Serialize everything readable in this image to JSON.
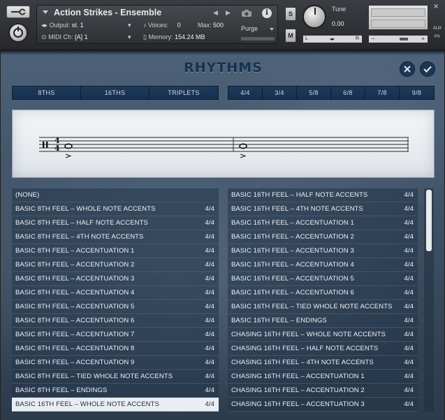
{
  "header": {
    "instrument_title": "Action Strikes - Ensemble",
    "output_label": "Output:",
    "output_value": "st. 1",
    "midi_label": "MIDI Ch:",
    "midi_value": "[A]  1",
    "voices_label": "Voices:",
    "voices_value": "0",
    "max_label": "Max:",
    "max_value": "500",
    "memory_label": "Memory:",
    "memory_value": "154.24 MB",
    "purge_label": "Purge",
    "solo_label": "S",
    "mute_label": "M",
    "tune_label": "Tune",
    "tune_value": "0.00",
    "pan_left": "L",
    "pan_right": "R",
    "vol_minus": "−",
    "vol_plus": "+",
    "aux_label": "AUX",
    "pv_label": "PV",
    "close_x": "×"
  },
  "panel": {
    "title": "RHYTHMS"
  },
  "feel_tabs": [
    "8THS",
    "16THS",
    "TRIPLETS"
  ],
  "meter_tabs": [
    "4/4",
    "3/4",
    "5/8",
    "6/8",
    "7/8",
    "9/8"
  ],
  "notation": {
    "time_signature_top": "4",
    "time_signature_bottom": "4"
  },
  "left_list": [
    {
      "name": "(NONE)",
      "meter": ""
    },
    {
      "name": "BASIC 8TH FEEL – WHOLE NOTE ACCENTS",
      "meter": "4/4"
    },
    {
      "name": "BASIC 8TH FEEL – HALF NOTE ACCENTS",
      "meter": "4/4"
    },
    {
      "name": "BASIC 8TH FEEL – 4TH NOTE ACCENTS",
      "meter": "4/4"
    },
    {
      "name": "BASIC 8TH FEEL – ACCENTUATION 1",
      "meter": "4/4"
    },
    {
      "name": "BASIC 8TH FEEL – ACCENTUATION 2",
      "meter": "4/4"
    },
    {
      "name": "BASIC 8TH FEEL – ACCENTUATION 3",
      "meter": "4/4"
    },
    {
      "name": "BASIC 8TH FEEL – ACCENTUATION 4",
      "meter": "4/4"
    },
    {
      "name": "BASIC 8TH FEEL – ACCENTUATION 5",
      "meter": "4/4"
    },
    {
      "name": "BASIC 8TH FEEL – ACCENTUATION 6",
      "meter": "4/4"
    },
    {
      "name": "BASIC 8TH FEEL – ACCENTUATION 7",
      "meter": "4/4"
    },
    {
      "name": "BASIC 8TH FEEL – ACCENTUATION 8",
      "meter": "4/4"
    },
    {
      "name": "BASIC 8TH FEEL – ACCENTUATION 9",
      "meter": "4/4"
    },
    {
      "name": "BASIC 8TH FEEL – TIED WHOLE NOTE ACCENTS",
      "meter": "4/4"
    },
    {
      "name": "BASIC 8TH FEEL – ENDINGS",
      "meter": "4/4"
    },
    {
      "name": "BASIC 16TH FEEL – WHOLE NOTE ACCENTS",
      "meter": "4/4",
      "selected": true
    }
  ],
  "right_list": [
    {
      "name": "BASIC 16TH FEEL – HALF NOTE ACCENTS",
      "meter": "4/4"
    },
    {
      "name": "BASIC 16TH FEEL – 4TH NOTE ACCENTS",
      "meter": "4/4"
    },
    {
      "name": "BASIC 16TH FEEL – ACCENTUATION 1",
      "meter": "4/4"
    },
    {
      "name": "BASIC 16TH FEEL – ACCENTUATION 2",
      "meter": "4/4"
    },
    {
      "name": "BASIC 16TH FEEL – ACCENTUATION 3",
      "meter": "4/4"
    },
    {
      "name": "BASIC 16TH FEEL – ACCENTUATION 4",
      "meter": "4/4"
    },
    {
      "name": "BASIC 16TH FEEL – ACCENTUATION 5",
      "meter": "4/4"
    },
    {
      "name": "BASIC 16TH FEEL – ACCENTUATION 6",
      "meter": "4/4"
    },
    {
      "name": "BASIC 16TH FEEL – TIED WHOLE NOTE ACCENTS",
      "meter": "4/4"
    },
    {
      "name": "BASIC 16TH FEEL – ENDINGS",
      "meter": "4/4"
    },
    {
      "name": "CHASING 16TH FEEL – WHOLE NOTE ACCENTS",
      "meter": "4/4"
    },
    {
      "name": "CHASING 16TH FEEL – HALF NOTE ACCENTS",
      "meter": "4/4"
    },
    {
      "name": "CHASING 16TH FEEL – 4TH NOTE ACCENTS",
      "meter": "4/4"
    },
    {
      "name": "CHASING 16TH FEEL – ACCENTUATION 1",
      "meter": "4/4"
    },
    {
      "name": "CHASING 16TH FEEL – ACCENTUATION 2",
      "meter": "4/4"
    },
    {
      "name": "CHASING 16TH FEEL – ACCENTUATION 3",
      "meter": "4/4"
    }
  ],
  "scroll_position": 0.0,
  "colors": {
    "accent": "#1d3654",
    "selected_row": "#e9eef3"
  }
}
